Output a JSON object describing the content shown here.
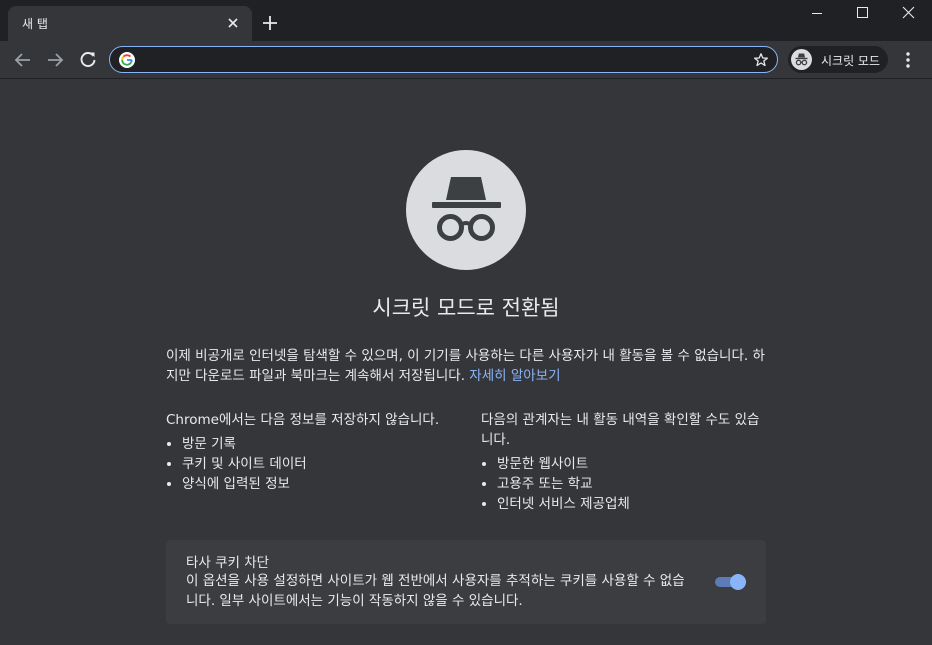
{
  "window": {
    "tab_title": "새 탭",
    "minimize_icon": "minimize-icon",
    "maximize_icon": "maximize-icon",
    "close_icon": "close-icon"
  },
  "toolbar": {
    "omnibox_value": "",
    "profile_label": "시크릿 모드"
  },
  "content": {
    "heading": "시크릿 모드로 전환됨",
    "intro_text": "이제 비공개로 인터넷을 탐색할 수 있으며, 이 기기를 사용하는 다른 사용자가 내 활동을 볼 수 없습니다. 하지만 다운로드 파일과 북마크는 계속해서 저장됩니다.",
    "learn_more": "자세히 알아보기",
    "left_column": {
      "title": "Chrome에서는 다음 정보를 저장하지 않습니다.",
      "items": [
        "방문 기록",
        "쿠키 및 사이트 데이터",
        "양식에 입력된 정보"
      ]
    },
    "right_column": {
      "title": "다음의 관계자는 내 활동 내역을 확인할 수도 있습니다.",
      "items": [
        "방문한 웹사이트",
        "고용주 또는 학교",
        "인터넷 서비스 제공업체"
      ]
    },
    "cookie_card": {
      "title": "타사 쿠키 차단",
      "description": "이 옵션을 사용 설정하면 사이트가 웹 전반에서 사용자를 추적하는 쿠키를 사용할 수 없습니다. 일부 사이트에서는 기능이 작동하지 않을 수 있습니다.",
      "toggle_on": true
    }
  },
  "colors": {
    "background": "#35363a",
    "tabstrip": "#202124",
    "link": "#8ab4f8",
    "card": "#3c3d41"
  }
}
